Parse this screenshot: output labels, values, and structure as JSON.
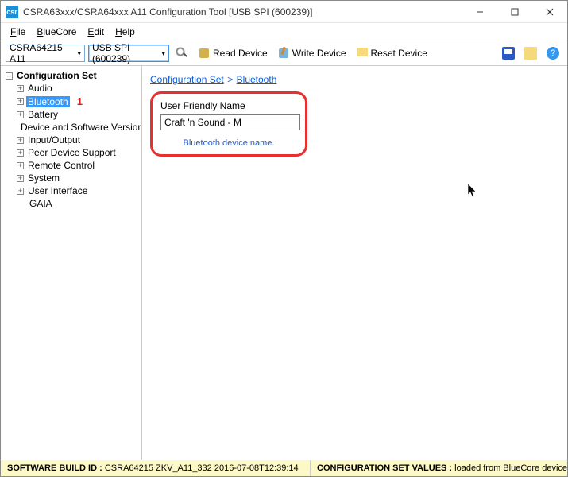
{
  "window": {
    "title": "CSRA63xxx/CSRA64xxx A11 Configuration Tool [USB SPI (600239)]"
  },
  "menu": {
    "file": "File",
    "bluecore": "BlueCore",
    "edit": "Edit",
    "help": "Help"
  },
  "toolbar": {
    "device_select": "CSRA64215 A11",
    "transport_select": "USB SPI (600239)",
    "read": "Read Device",
    "write": "Write Device",
    "reset": "Reset Device"
  },
  "tree": {
    "root": "Configuration Set",
    "items": [
      {
        "label": "Audio",
        "exp": "plus"
      },
      {
        "label": "Bluetooth",
        "exp": "plus",
        "selected": true
      },
      {
        "label": "Battery",
        "exp": "plus"
      },
      {
        "label": "Device and Software Version",
        "exp": "none"
      },
      {
        "label": "Input/Output",
        "exp": "plus"
      },
      {
        "label": "Peer Device Support",
        "exp": "plus"
      },
      {
        "label": "Remote Control",
        "exp": "plus"
      },
      {
        "label": "System",
        "exp": "plus"
      },
      {
        "label": "User Interface",
        "exp": "plus"
      },
      {
        "label": "GAIA",
        "exp": "none"
      }
    ],
    "callout": "1"
  },
  "breadcrumb": {
    "root": "Configuration Set",
    "leaf": "Bluetooth",
    "sep": ">"
  },
  "panel": {
    "field_label": "User Friendly Name",
    "field_value": "Craft 'n Sound - M",
    "hint": "Bluetooth device name."
  },
  "status": {
    "left_label": "SOFTWARE BUILD ID :",
    "left_value": "CSRA64215 ZKV_A11_332 2016-07-08T12:39:14",
    "right_label": "CONFIGURATION SET VALUES :",
    "right_value": "loaded from BlueCore device"
  }
}
